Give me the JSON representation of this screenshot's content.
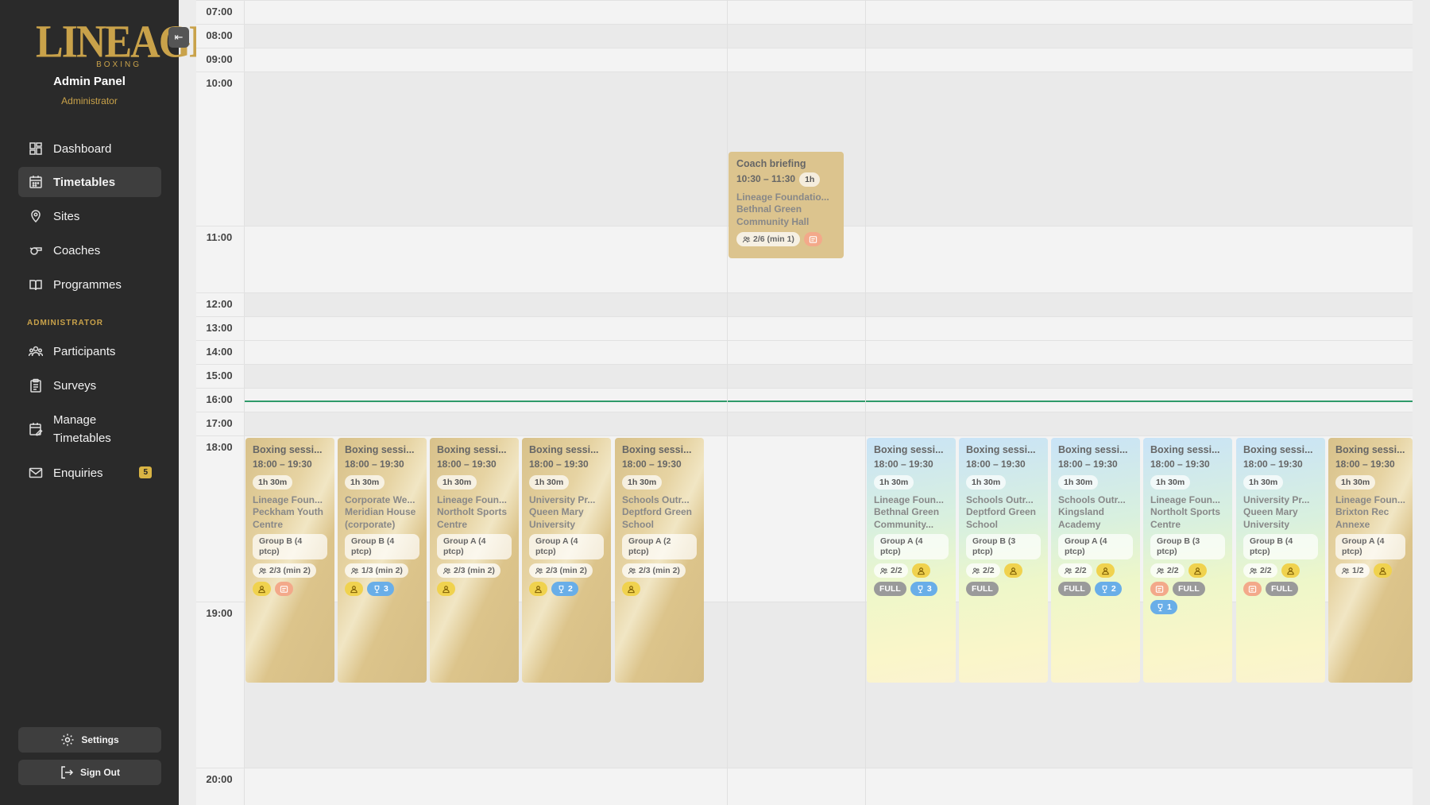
{
  "sidebar": {
    "logo_text": "LINEAGE",
    "logo_sub": "BOXING",
    "title": "Admin Panel",
    "role": "Administrator",
    "nav": [
      {
        "label": "Dashboard",
        "icon": "dashboard-icon"
      },
      {
        "label": "Timetables",
        "icon": "calendar-icon",
        "active": true
      },
      {
        "label": "Sites",
        "icon": "location-pin-icon"
      },
      {
        "label": "Coaches",
        "icon": "whistle-icon"
      },
      {
        "label": "Programmes",
        "icon": "book-icon"
      }
    ],
    "section_label": "ADMINISTRATOR",
    "admin_nav": [
      {
        "label": "Participants",
        "icon": "people-icon"
      },
      {
        "label": "Surveys",
        "icon": "clipboard-icon"
      },
      {
        "label": "Manage Timetables",
        "icon": "calendar-edit-icon"
      },
      {
        "label": "Enquiries",
        "icon": "mail-icon",
        "badge": "5"
      }
    ],
    "settings_label": "Settings",
    "signout_label": "Sign Out"
  },
  "calendar": {
    "times": [
      "07:00",
      "08:00",
      "09:00",
      "10:00",
      "11:00",
      "12:00",
      "13:00",
      "14:00",
      "15:00",
      "16:00",
      "17:00",
      "18:00",
      "19:00",
      "20:00"
    ],
    "colors": {
      "now_line": "#2f9a6a",
      "gold": "#d8c18a",
      "coach_chip": "#f0d24e",
      "survey_chip": "#f3a98a",
      "trophy_chip": "#69aee8",
      "full_chip": "#9a9a9a"
    },
    "briefing": {
      "title": "Coach briefing",
      "time": "10:30 – 11:30",
      "duration": "1h",
      "programme": "Lineage Foundatio...",
      "site": "Bethnal Green Community Hall",
      "capacity": "2/6 (min 1)"
    },
    "events": [
      {
        "title": "Boxing sessi...",
        "time": "18:00 – 19:30",
        "duration": "1h 30m",
        "programme": "Lineage Foun...",
        "site": "Peckham Youth Centre",
        "group": "Group B (4 ptcp)",
        "capacity": "2/3 (min 2)",
        "coach": true,
        "survey": true
      },
      {
        "title": "Boxing sessi...",
        "time": "18:00 – 19:30",
        "duration": "1h 30m",
        "programme": "Corporate We...",
        "site": "Meridian House (corporate)",
        "group": "Group B (4 ptcp)",
        "capacity": "1/3 (min 2)",
        "coach": true,
        "trophy": "3"
      },
      {
        "title": "Boxing sessi...",
        "time": "18:00 – 19:30",
        "duration": "1h 30m",
        "programme": "Lineage Foun...",
        "site": "Northolt Sports Centre",
        "group": "Group A (4 ptcp)",
        "capacity": "2/3 (min 2)",
        "coach": true
      },
      {
        "title": "Boxing sessi...",
        "time": "18:00 – 19:30",
        "duration": "1h 30m",
        "programme": "University Pr...",
        "site": "Queen Mary University",
        "group": "Group A (4 ptcp)",
        "capacity": "2/3 (min 2)",
        "coach": true,
        "trophy": "2"
      },
      {
        "title": "Boxing sessi...",
        "time": "18:00 – 19:30",
        "duration": "1h 30m",
        "programme": "Schools Outr...",
        "site": "Deptford Green School",
        "group": "Group A (2 ptcp)",
        "capacity": "2/3 (min 2)",
        "coach": true
      },
      {
        "title": "Boxing sessi...",
        "time": "18:00 – 19:30",
        "duration": "1h 30m",
        "programme": "Lineage Foun...",
        "site": "Bethnal Green Community...",
        "group": "Group A (4 ptcp)",
        "capacity": "2/2",
        "coach": true,
        "full": "FULL",
        "trophy": "3"
      },
      {
        "title": "Boxing sessi...",
        "time": "18:00 – 19:30",
        "duration": "1h 30m",
        "programme": "Schools Outr...",
        "site": "Deptford Green School",
        "group": "Group B (3 ptcp)",
        "capacity": "2/2",
        "coach": true,
        "full": "FULL"
      },
      {
        "title": "Boxing sessi...",
        "time": "18:00 – 19:30",
        "duration": "1h 30m",
        "programme": "Schools Outr...",
        "site": "Kingsland Academy",
        "group": "Group A (4 ptcp)",
        "capacity": "2/2",
        "coach": true,
        "full": "FULL",
        "trophy": "2"
      },
      {
        "title": "Boxing sessi...",
        "time": "18:00 – 19:30",
        "duration": "1h 30m",
        "programme": "Lineage Foun...",
        "site": "Northolt Sports Centre",
        "group": "Group B (3 ptcp)",
        "capacity": "2/2",
        "coach": true,
        "survey": true,
        "full": "FULL",
        "trophy": "1"
      },
      {
        "title": "Boxing sessi...",
        "time": "18:00 – 19:30",
        "duration": "1h 30m",
        "programme": "University Pr...",
        "site": "Queen Mary University",
        "group": "Group B (4 ptcp)",
        "capacity": "2/2",
        "coach": true,
        "survey": true,
        "full": "FULL"
      },
      {
        "title": "Boxing sessi...",
        "time": "18:00 – 19:30",
        "duration": "1h 30m",
        "programme": "Lineage Foun...",
        "site": "Brixton Rec Annexe",
        "group": "Group A (4 ptcp)",
        "capacity": "1/2",
        "coach": true
      }
    ]
  }
}
